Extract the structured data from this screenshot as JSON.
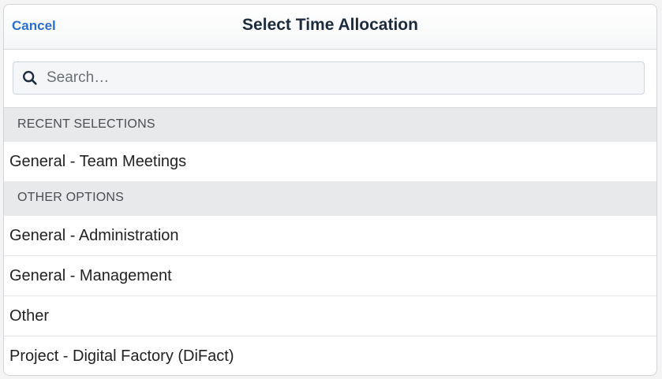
{
  "header": {
    "cancel_label": "Cancel",
    "title": "Select Time Allocation"
  },
  "search": {
    "placeholder": "Search…",
    "value": ""
  },
  "sections": {
    "recent": {
      "label": "RECENT SELECTIONS",
      "items": [
        "General - Team Meetings"
      ]
    },
    "other": {
      "label": "OTHER OPTIONS",
      "items": [
        "General - Administration",
        "General - Management",
        "Other",
        "Project - Digital Factory (DiFact)"
      ]
    }
  },
  "colors": {
    "accent": "#2a6fc9",
    "title": "#1c2b3d",
    "section_bg": "#e8e9ea"
  },
  "icons": {
    "search": "search-icon"
  }
}
